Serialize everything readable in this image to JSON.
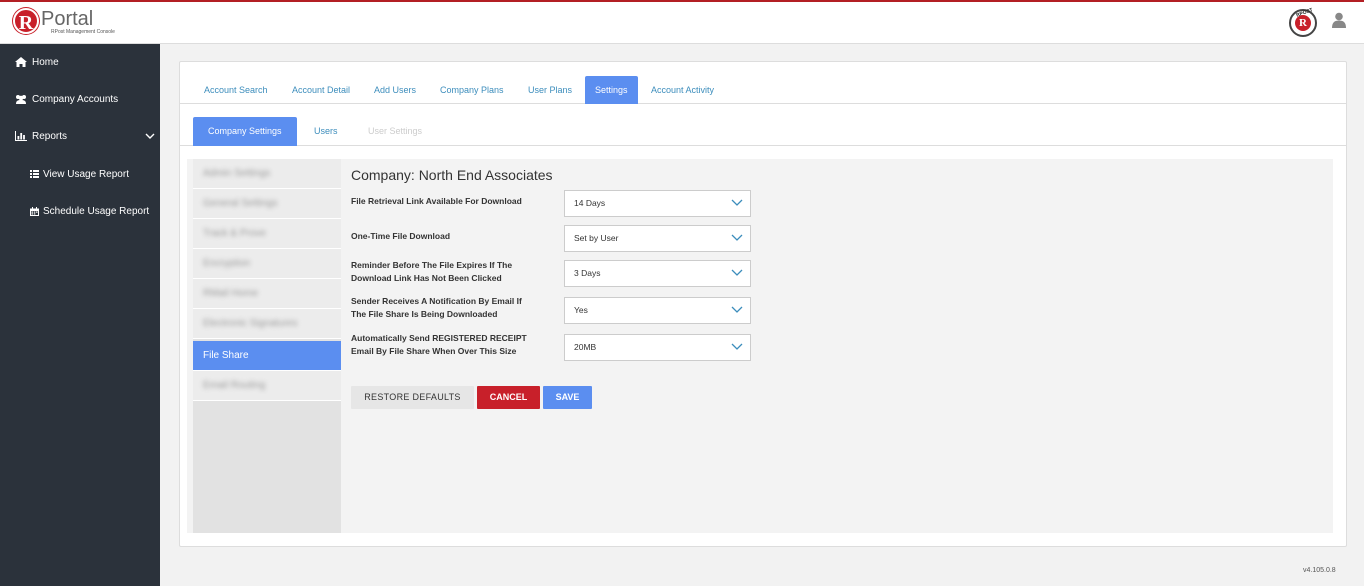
{
  "brand": {
    "logo_letter": "R",
    "title": "Portal",
    "subtitle": "RPost Management Console",
    "badge_letter": "R",
    "badge_text": "RPOST"
  },
  "icons": {
    "user": "user-icon",
    "home": "home-icon",
    "accounts": "users-icon",
    "reports": "bar-chart-icon",
    "view_usage": "list-icon",
    "schedule_usage": "calendar-icon",
    "expand": "chevron-down-icon",
    "select_caret": "chevron-down-icon"
  },
  "sidebar": {
    "items": [
      {
        "label": "Home"
      },
      {
        "label": "Company Accounts"
      },
      {
        "label": "Reports"
      },
      {
        "label": "View Usage Report"
      },
      {
        "label": "Schedule Usage Report"
      }
    ]
  },
  "tabs": [
    {
      "label": "Account Search",
      "active": false
    },
    {
      "label": "Account Detail",
      "active": false
    },
    {
      "label": "Add Users",
      "active": false
    },
    {
      "label": "Company Plans",
      "active": false
    },
    {
      "label": "User Plans",
      "active": false
    },
    {
      "label": "Settings",
      "active": true
    },
    {
      "label": "Account Activity",
      "active": false
    }
  ],
  "subtabs": [
    {
      "label": "Company Settings",
      "state": "active"
    },
    {
      "label": "Users",
      "state": "normal"
    },
    {
      "label": "User Settings",
      "state": "disabled"
    }
  ],
  "left_menu": {
    "items": [
      {
        "label": "Admin Settings",
        "blurred": true
      },
      {
        "label": "General Settings",
        "blurred": true
      },
      {
        "label": "Track & Prove",
        "blurred": true
      },
      {
        "label": "Encryption",
        "blurred": true
      },
      {
        "label": "RMail Home",
        "blurred": true
      },
      {
        "label": "Electronic Signatures",
        "blurred": true
      },
      {
        "label": "File Share",
        "blurred": false,
        "active": true
      },
      {
        "label": "Email Routing",
        "blurred": true
      }
    ]
  },
  "form": {
    "company_title": "Company: North End Associates",
    "fields": [
      {
        "label_line1": "File Retrieval Link Available For Download",
        "label_line2": "",
        "value": "14 Days"
      },
      {
        "label_line1": "One-Time File Download",
        "label_line2": "",
        "value": "Set by User"
      },
      {
        "label_line1": "Reminder Before The File Expires If The",
        "label_line2": "Download Link Has Not Been Clicked",
        "value": "3 Days"
      },
      {
        "label_line1": "Sender Receives A Notification By Email If",
        "label_line2": "The File Share Is Being Downloaded",
        "value": "Yes"
      },
      {
        "label_line1": "Automatically Send REGISTERED RECEIPT",
        "label_line2": "Email By File Share When Over This Size",
        "value": "20MB"
      }
    ],
    "buttons": {
      "restore": "RESTORE DEFAULTS",
      "cancel": "CANCEL",
      "save": "SAVE"
    }
  },
  "footer": {
    "version": "v4.105.0.8"
  },
  "colors": {
    "accent_blue": "#5b8ef0",
    "brand_red": "#c8202a",
    "sidebar_bg": "#2b323b",
    "link_blue": "#3c8dbc"
  }
}
